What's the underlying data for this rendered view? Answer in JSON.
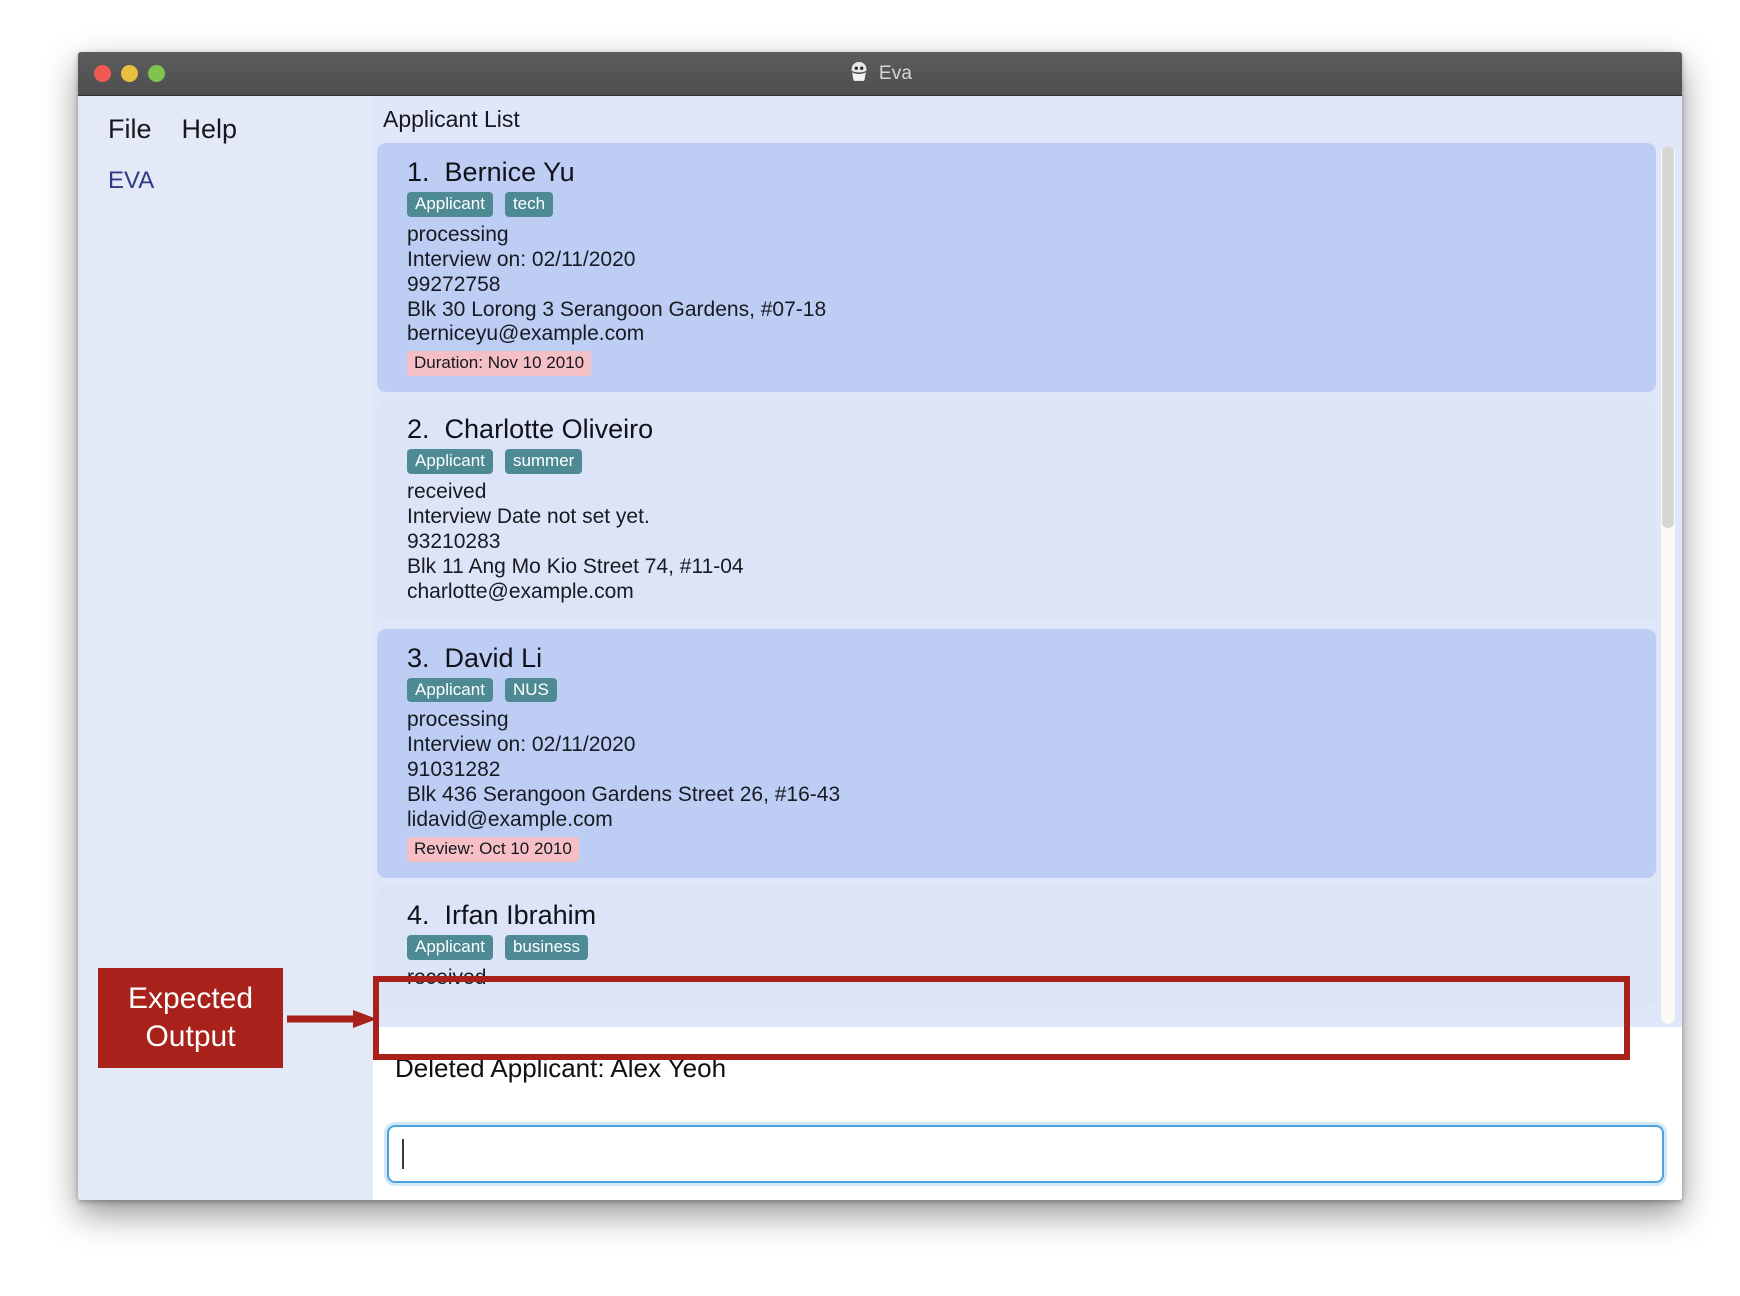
{
  "window": {
    "title": "Eva",
    "title_icon": "robot-icon",
    "traffic_lights": [
      "close",
      "minimize",
      "maximize"
    ]
  },
  "sidebar": {
    "menu": [
      {
        "label": "File"
      },
      {
        "label": "Help"
      }
    ],
    "app_label": "EVA"
  },
  "main": {
    "list_header": "Applicant List",
    "applicants": [
      {
        "index": "1.",
        "name": "Bernice Yu",
        "tags": [
          "Applicant",
          "tech"
        ],
        "status": "processing",
        "interview": "Interview on: 02/11/2020",
        "phone": "99272758",
        "address": "Blk 30 Lorong 3 Serangoon Gardens, #07-18",
        "email": "berniceyu@example.com",
        "pill": "Duration: Nov 10 2010"
      },
      {
        "index": "2.",
        "name": "Charlotte Oliveiro",
        "tags": [
          "Applicant",
          "summer"
        ],
        "status": "received",
        "interview": "Interview Date not set yet.",
        "phone": "93210283",
        "address": "Blk 11 Ang Mo Kio Street 74, #11-04",
        "email": "charlotte@example.com",
        "pill": ""
      },
      {
        "index": "3.",
        "name": "David Li",
        "tags": [
          "Applicant",
          "NUS"
        ],
        "status": "processing",
        "interview": "Interview on: 02/11/2020",
        "phone": "91031282",
        "address": "Blk 436 Serangoon Gardens Street 26, #16-43",
        "email": "lidavid@example.com",
        "pill": "Review: Oct 10 2010"
      },
      {
        "index": "4.",
        "name": "Irfan Ibrahim",
        "tags": [
          "Applicant",
          "business"
        ],
        "status": "received",
        "interview": "",
        "phone": "",
        "address": "",
        "email": "",
        "pill": ""
      }
    ],
    "result_text": "Deleted Applicant: Alex Yeoh",
    "command_value": "",
    "command_placeholder": ""
  },
  "annotation": {
    "label_line1": "Expected",
    "label_line2": "Output",
    "color": "#a8211b"
  },
  "colors": {
    "card_odd": "#bdcdf3",
    "card_even": "#dee4f8",
    "tag": "#4e8a94",
    "pill": "#f5bfc6",
    "sidebar": "#e4e9f8",
    "accent_input": "#4aa3df"
  }
}
